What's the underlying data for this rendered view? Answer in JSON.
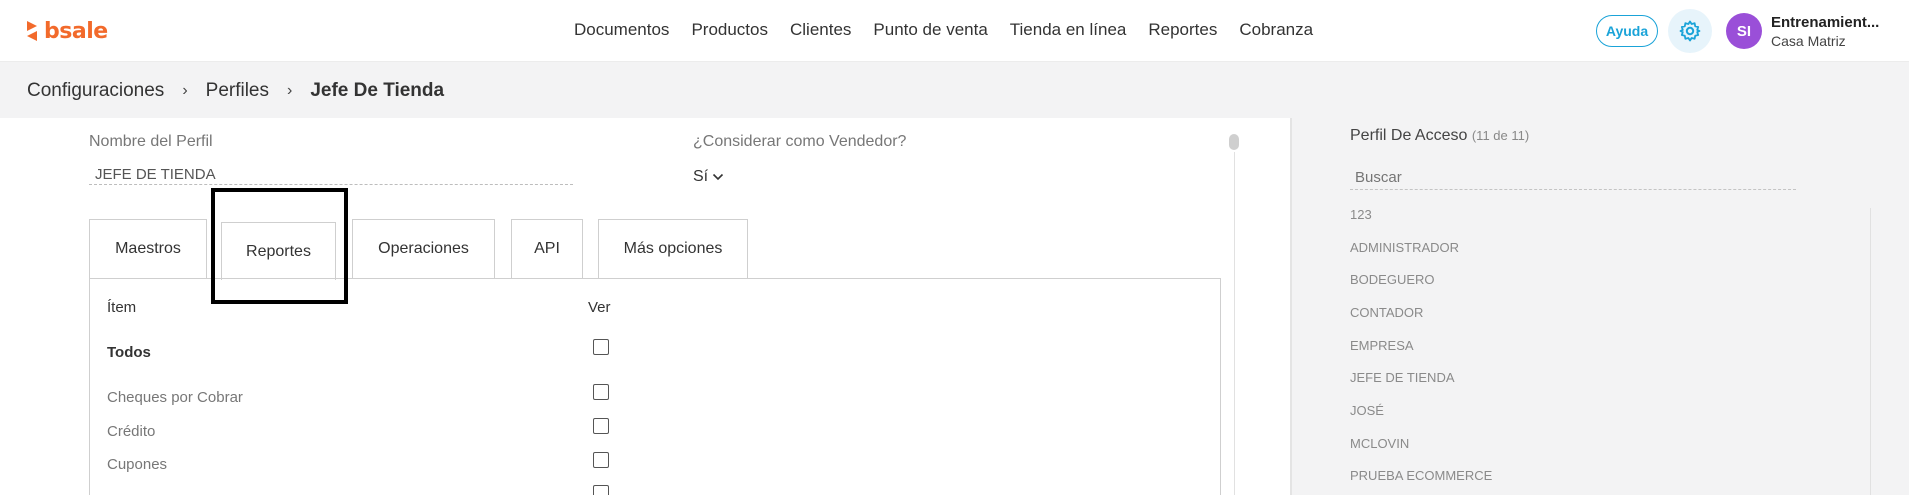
{
  "header": {
    "logo_text": "bsale",
    "nav": [
      "Documentos",
      "Productos",
      "Clientes",
      "Punto de venta",
      "Tienda en línea",
      "Reportes",
      "Cobranza"
    ],
    "help_label": "Ayuda",
    "avatar_initials": "SI",
    "user_name": "Entrenamient...",
    "user_branch": "Casa Matriz",
    "brand_color": "#f26a2b",
    "accent_color": "#1aa3d8"
  },
  "breadcrumb": {
    "items": [
      "Configuraciones",
      "Perfiles"
    ],
    "current": "Jefe De Tienda"
  },
  "form": {
    "profile_name_label": "Nombre del Perfil",
    "profile_name_value": "JEFE DE TIENDA",
    "seller_label": "¿Considerar como Vendedor?",
    "seller_value": "Sí"
  },
  "tabs": [
    "Maestros",
    "Reportes",
    "Operaciones",
    "API",
    "Más opciones"
  ],
  "active_tab": "Reportes",
  "table": {
    "col_item": "Ítem",
    "col_view": "Ver",
    "rows": [
      "Todos",
      "Cheques por Cobrar",
      "Crédito",
      "Cupones"
    ]
  },
  "access_panel": {
    "title": "Perfil De Acceso",
    "count": "(11 de 11)",
    "search_placeholder": "Buscar",
    "profiles": [
      "123",
      "ADMINISTRADOR",
      "BODEGUERO",
      "CONTADOR",
      "EMPRESA",
      "JEFE DE TIENDA",
      "JOSÉ",
      "MCLOVIN",
      "PRUEBA ECOMMERCE"
    ]
  }
}
